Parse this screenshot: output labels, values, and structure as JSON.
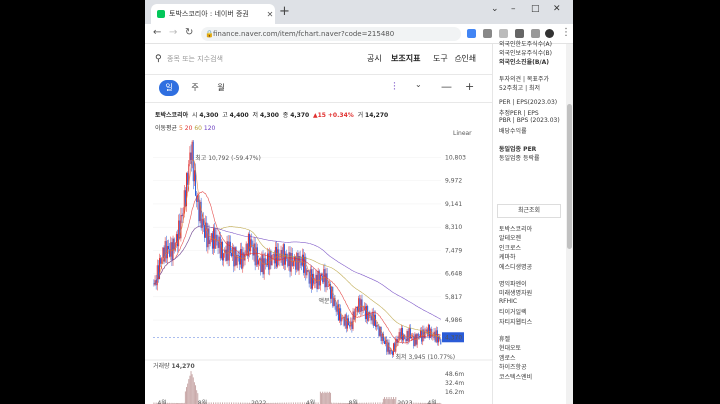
{
  "browser": {
    "tab_title": "토박스코리아 : 네이버 증권",
    "url": "finance.naver.com/item/fchart.naver?code=215480"
  },
  "header": {
    "search_placeholder": "종목 또는 지수검색",
    "menu": [
      "공시",
      "보조지표",
      "도구",
      "인쇄"
    ]
  },
  "periods": [
    "일",
    "주",
    "월"
  ],
  "quote": {
    "name": "토박스코리아",
    "open_label": "시",
    "open": "4,300",
    "high_label": "고",
    "high": "4,400",
    "low_label": "저",
    "low": "4,300",
    "close_label": "종",
    "close": "4,370",
    "change": "▲15",
    "change_pct": "+0.34%",
    "volume_label": "거",
    "volume": "14,270"
  },
  "moving_average": {
    "label": "이동평균",
    "periods": [
      "5",
      "20",
      "60",
      "120"
    ],
    "colors": [
      "#e57a33",
      "#e0302f",
      "#b7a03b",
      "#6b3fc0"
    ]
  },
  "scale_mode": "Linear",
  "chart_data": {
    "type": "candlestick",
    "price_axis_ticks": [
      "10,803",
      "9,972",
      "9,141",
      "8,310",
      "7,479",
      "6,648",
      "5,817",
      "4,986"
    ],
    "current_price_tag": "4,370",
    "high_annotation": "최고 10,792 (-59.47%)",
    "low_annotation": "최저 3,945 (10.77%)",
    "event_annotation": "액분",
    "volume_label": "거래량",
    "volume_value": "14,270",
    "volume_axis_ticks": [
      "48.6m",
      "32.4m",
      "16.2m"
    ],
    "x_ticks": [
      "4월",
      "8월",
      "2022",
      "4월",
      "8월",
      "2023",
      "4월"
    ],
    "close_path": [
      [
        0,
        6300
      ],
      [
        4,
        7100
      ],
      [
        8,
        7400
      ],
      [
        12,
        8600
      ],
      [
        15,
        9700
      ],
      [
        17,
        10792
      ],
      [
        19,
        9300
      ],
      [
        22,
        8700
      ],
      [
        25,
        8000
      ],
      [
        28,
        7600
      ],
      [
        31,
        7200
      ],
      [
        34,
        7800
      ],
      [
        37,
        7300
      ],
      [
        40,
        6900
      ],
      [
        43,
        7700
      ],
      [
        46,
        7500
      ],
      [
        49,
        7000
      ],
      [
        52,
        6900
      ],
      [
        55,
        7200
      ],
      [
        58,
        7600
      ],
      [
        61,
        7100
      ],
      [
        64,
        6800
      ],
      [
        67,
        7000
      ],
      [
        70,
        6700
      ],
      [
        73,
        6400
      ],
      [
        76,
        6300
      ],
      [
        79,
        6000
      ],
      [
        82,
        5500
      ],
      [
        84,
        5100
      ],
      [
        86,
        4800
      ],
      [
        88,
        4600
      ],
      [
        90,
        5300
      ],
      [
        92,
        5700
      ],
      [
        94,
        5500
      ],
      [
        96,
        5200
      ],
      [
        98,
        4900
      ],
      [
        100,
        4500
      ],
      [
        102,
        4300
      ],
      [
        104,
        4150
      ],
      [
        106,
        3945
      ],
      [
        108,
        4200
      ],
      [
        110,
        4400
      ],
      [
        112,
        4150
      ],
      [
        114,
        4500
      ],
      [
        116,
        4350
      ],
      [
        118,
        4600
      ],
      [
        120,
        4450
      ],
      [
        122,
        4500
      ],
      [
        124,
        4300
      ],
      [
        126,
        4400
      ],
      [
        128,
        4370
      ]
    ]
  },
  "sidebar": {
    "top_items": [
      "외국인한도주식수(A)",
      "외국인보유주식수(B)",
      "외국인소진율(B/A)",
      "투자의견 | 목표주가",
      "52주최고 | 최저",
      "PER | EPS(2023.03)",
      "추정PER | EPS",
      "PBR | BPS (2023.03)",
      "배당수익률",
      "동일업종 PER",
      "동일업종 등락률"
    ],
    "recent_label": "최근조회",
    "recent_items": [
      "토박스코리아",
      "알테오젠",
      "인크로스",
      "케마하",
      "에스디생명공",
      "명익파엔이",
      "미래생명자원",
      "RFHIC",
      "티이거일렉",
      "자티지웹티스",
      "휴젤",
      "현대오토",
      "엠로스",
      "하이즈항공",
      "코스텍스엔비"
    ]
  }
}
